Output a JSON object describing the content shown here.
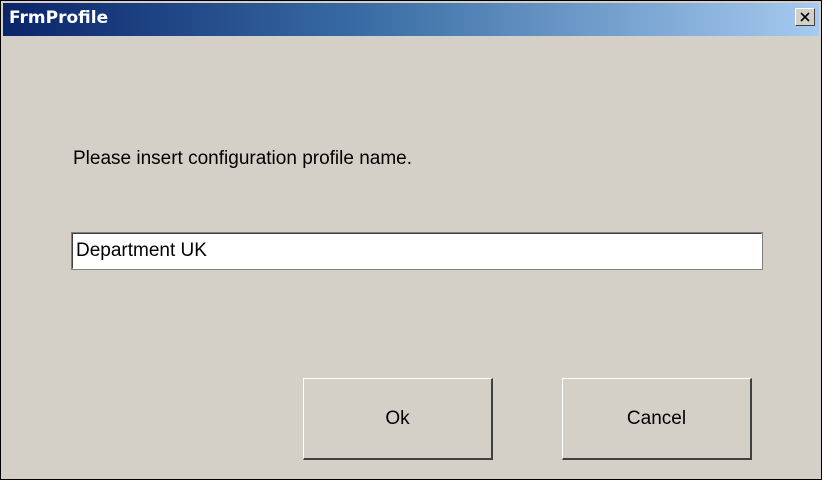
{
  "window": {
    "title": "FrmProfile",
    "close_icon": "close-icon"
  },
  "dialog": {
    "prompt": "Please insert configuration profile name.",
    "profile_name_value": "Department UK",
    "ok_label": "Ok",
    "cancel_label": "Cancel"
  },
  "colors": {
    "window_background": "#d4d0c8",
    "titlebar_start": "#0a246a",
    "titlebar_end": "#a6caf0",
    "title_text": "#ffffff"
  }
}
